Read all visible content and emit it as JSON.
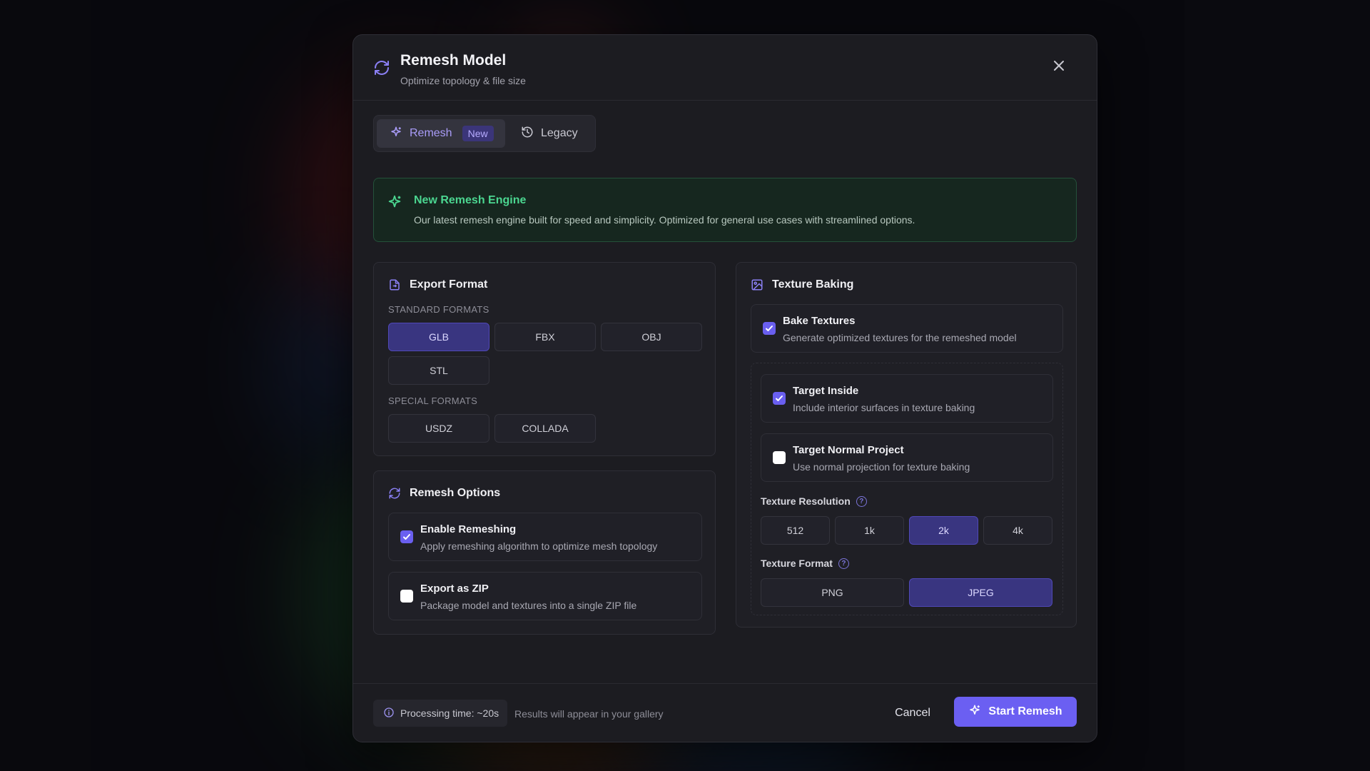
{
  "modal": {
    "title": "Remesh Model",
    "subtitle": "Optimize topology & file size"
  },
  "tabs": [
    {
      "label": "Remesh",
      "badge": "New",
      "selected": true
    },
    {
      "label": "Legacy",
      "selected": false
    }
  ],
  "banner": {
    "title": "New Remesh Engine",
    "text": "Our latest remesh engine built for speed and simplicity. Optimized for general use cases with streamlined options."
  },
  "export_format": {
    "title": "Export Format",
    "standard_label": "STANDARD FORMATS",
    "standard": [
      "GLB",
      "FBX",
      "OBJ",
      "STL"
    ],
    "special_label": "SPECIAL FORMATS",
    "special": [
      "USDZ",
      "COLLADA"
    ],
    "selected": "GLB"
  },
  "remesh_options": {
    "title": "Remesh Options",
    "options": [
      {
        "title": "Enable Remeshing",
        "desc": "Apply remeshing algorithm to optimize mesh topology",
        "checked": true
      },
      {
        "title": "Export as ZIP",
        "desc": "Package model and textures into a single ZIP file",
        "checked": false
      }
    ]
  },
  "texture_baking": {
    "title": "Texture Baking",
    "bake": {
      "title": "Bake Textures",
      "desc": "Generate optimized textures for the remeshed model",
      "checked": true
    },
    "target_inside": {
      "title": "Target Inside",
      "desc": "Include interior surfaces in texture baking",
      "checked": true
    },
    "target_normal": {
      "title": "Target Normal Project",
      "desc": "Use normal projection for texture baking",
      "checked": false
    },
    "resolution_label": "Texture Resolution",
    "resolutions": [
      "512",
      "1k",
      "2k",
      "4k"
    ],
    "resolution_selected": "2k",
    "format_label": "Texture Format",
    "formats": [
      "PNG",
      "JPEG"
    ],
    "format_selected": "JPEG"
  },
  "footer": {
    "processing": "Processing time: ~20s",
    "results": "Results will appear in your gallery",
    "cancel": "Cancel",
    "start": "Start Remesh"
  },
  "colors": {
    "accent": "#6b5ff2",
    "selected_bg": "#393580",
    "banner_green": "#4bd690"
  }
}
